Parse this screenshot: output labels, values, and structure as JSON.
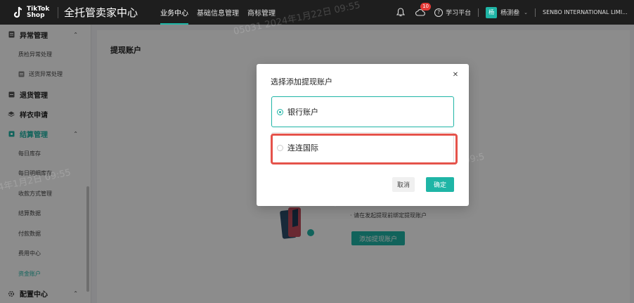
{
  "header": {
    "logo_line1": "TikTok",
    "logo_line2": "Shop",
    "app_title": "全托管卖家中心",
    "tabs": [
      {
        "label": "业务中心",
        "active": true
      },
      {
        "label": "基础信息管理",
        "active": false
      },
      {
        "label": "商标管理",
        "active": false
      }
    ],
    "notification_count": "10",
    "help_label": "学习平台",
    "avatar_text": "杨",
    "user_name": "杨测叁",
    "company": "SENBO INTERNATIONAL LIMI..."
  },
  "sidebar": {
    "groups": [
      {
        "label": "异常管理",
        "icon": "document-icon"
      },
      {
        "label": "退货管理",
        "icon": "return-icon"
      },
      {
        "label": "样衣申请",
        "icon": "layers-icon"
      },
      {
        "label": "结算管理",
        "icon": "settlement-icon"
      },
      {
        "label": "配置中心",
        "icon": "gear-icon"
      }
    ],
    "items": {
      "quality": "质检异常处理",
      "delivery": "送货异常处理",
      "daily_stock": "每日库存",
      "daily_detail": "每日明细库存",
      "payment_method": "收款方式管理",
      "settlement_data": "结算数据",
      "payment_data": "付款数据",
      "fees": "费用中心",
      "fund_account": "资金账户"
    }
  },
  "main": {
    "page_title": "提现账户",
    "empty_text": "请在发起提现前绑定提现账户",
    "add_button": "添加提现账户"
  },
  "modal": {
    "title": "选择添加提现账户",
    "options": [
      {
        "label": "银行账户",
        "selected": true
      },
      {
        "label": "连连国际",
        "selected": false
      }
    ],
    "cancel": "取消",
    "confirm": "确定"
  },
  "watermarks": [
    "4年1月2日 09:55",
    "05031 2024年1月22日 09:55",
    "2024年1月22日 09:5",
    "05031 2024年1月22日 09:55"
  ],
  "colors": {
    "accent": "#1fb5a6",
    "topbar": "#1e1e1e",
    "highlight": "#e5534b",
    "badge": "#e53935"
  }
}
